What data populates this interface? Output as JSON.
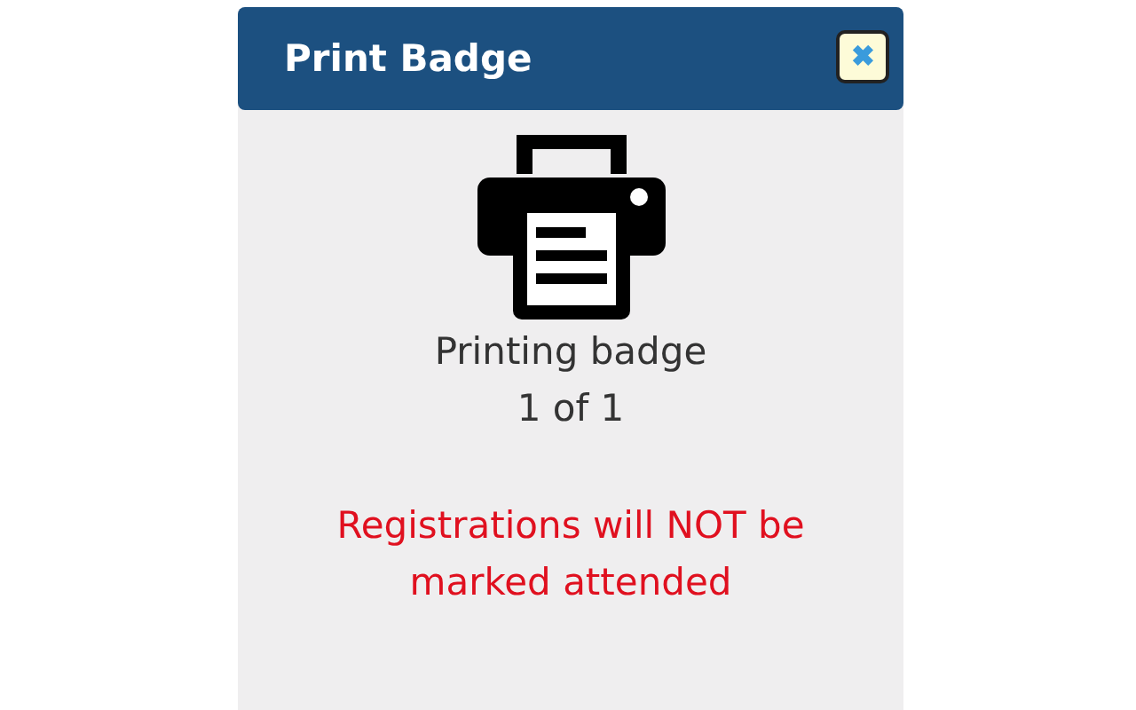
{
  "dialog": {
    "title": "Print Badge",
    "close_button": {
      "label": "✖"
    }
  },
  "status": [
    "Printing badge",
    "1 of 1"
  ],
  "warning": "Registrations will NOT be marked attended"
}
